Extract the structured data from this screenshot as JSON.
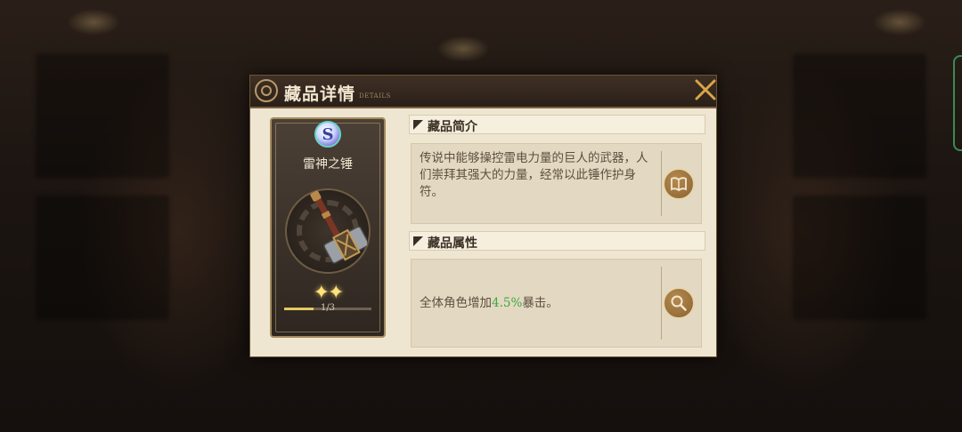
{
  "dialog": {
    "title": "藏品详情",
    "subtitle": "DETAILS"
  },
  "item": {
    "rarity_letter": "S",
    "name": "雷神之锤",
    "stars": "✦✦",
    "progress_label": "1/3",
    "progress_fraction": 0.333
  },
  "intro": {
    "header": "藏品简介",
    "description": "传说中能够操控雷电力量的巨人的武器，人们崇拜其强大的力量，经常以此锤作护身符。",
    "button_icon": "book-icon"
  },
  "attributes": {
    "header": "藏品属性",
    "text_prefix": "全体角色增加",
    "value": "4.5%",
    "text_suffix": "暴击。",
    "button_icon": "magnifier-icon",
    "value_color": "#3fa83f"
  },
  "colors": {
    "title_bar": "#2a2019",
    "panel": "#efe6d2",
    "accent_gold": "#b58a4f"
  }
}
